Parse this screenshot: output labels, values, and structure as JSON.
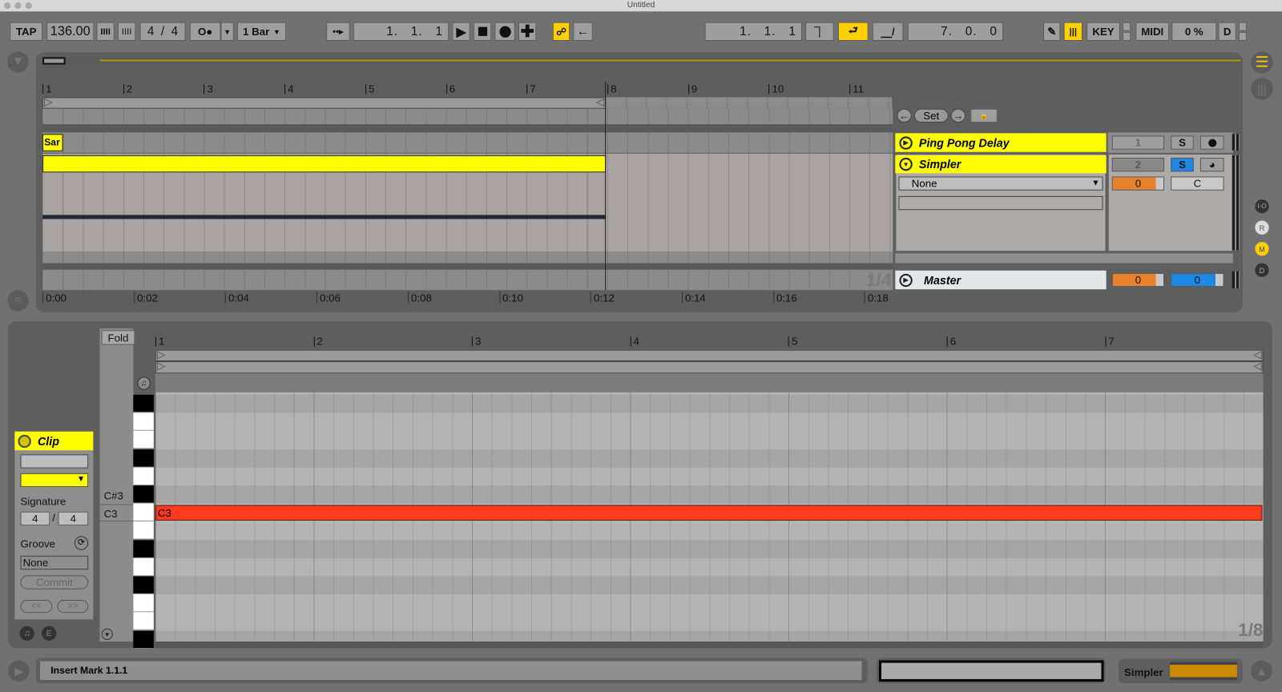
{
  "window": {
    "title": "Untitled"
  },
  "toolbar": {
    "tap": "TAP",
    "tempo": "136.00",
    "nudge_down": "IIII",
    "nudge_up": "IIII",
    "signature": "4  /  4",
    "metronome": "O●",
    "quantize": "1 Bar",
    "position": "1.   1.   1",
    "loop_start": "1.   1.   1",
    "loop_length": "7.   0.   0",
    "key": "KEY",
    "midi": "MIDI",
    "cpu": "0 %",
    "disk": "D",
    "accent": "#ffd000"
  },
  "arrangement": {
    "bar_numbers": [
      "1",
      "2",
      "3",
      "4",
      "5",
      "6",
      "7",
      "8",
      "9",
      "10",
      "11"
    ],
    "time_labels": [
      "0:00",
      "0:02",
      "0:04",
      "0:06",
      "0:08",
      "0:10",
      "0:12",
      "0:14",
      "0:16",
      "0:18"
    ],
    "clip_label": "Sar",
    "grid_quant": "1/4",
    "locator": {
      "set": "Set"
    },
    "tracks": [
      {
        "name": "Ping Pong Delay",
        "number": "1",
        "solo": "S",
        "color": "#ffff00"
      },
      {
        "name": "Simpler",
        "number": "2",
        "solo": "S",
        "input": "None",
        "volume": "0",
        "pan": "C",
        "color": "#ffff00"
      }
    ],
    "master": {
      "name": "Master",
      "volume": "0",
      "pan": "0"
    },
    "side_buttons": [
      "I-O",
      "R",
      "M",
      "D"
    ]
  },
  "clip": {
    "title": "Clip",
    "signature_label": "Signature",
    "sig_num": "4",
    "sig_den": "4",
    "groove_label": "Groove",
    "groove": "None",
    "commit": "Commit",
    "prev": "<<",
    "next": ">>"
  },
  "piano_roll": {
    "fold": "Fold",
    "bar_numbers": [
      "1",
      "2",
      "3",
      "4",
      "5",
      "6",
      "7"
    ],
    "key_labels": {
      "csharp3": "C#3",
      "c3": "C3"
    },
    "note": {
      "label": "C3",
      "color": "#ff3a1e"
    },
    "grid_quant": "1/8"
  },
  "status": {
    "message": "Insert Mark 1.1.1",
    "device": "Simpler"
  }
}
